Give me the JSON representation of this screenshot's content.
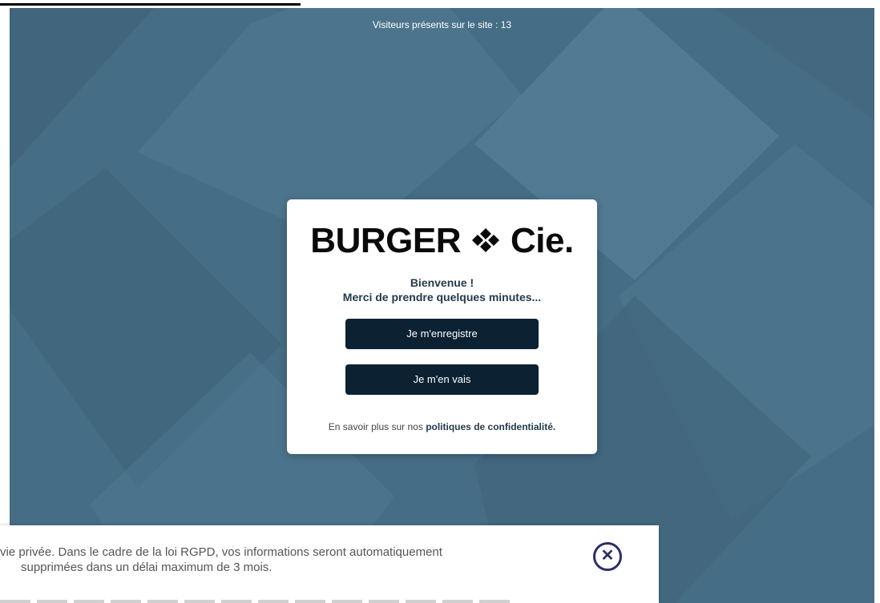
{
  "colors": {
    "background": "#466d86",
    "card": "#ffffff",
    "button": "#0c2233",
    "close_icon": "#2b2f67"
  },
  "header": {
    "visitors_text": "Visiteurs présents sur le site : 13"
  },
  "card": {
    "logo_left": "BURGER",
    "logo_right": "Cie.",
    "logo_icon": "diamond-cluster-icon",
    "welcome_line1": "Bienvenue !",
    "welcome_line2": "Merci de prendre quelques minutes...",
    "register_button": "Je m'enregistre",
    "leave_button": "Je m'en vais",
    "privacy_prefix": "En savoir plus sur nos",
    "privacy_link": "politiques de confidentialité."
  },
  "banner": {
    "line1": "vie privée. Dans le cadre de la loi RGPD, vos informations seront automatiquement",
    "line2": "supprimées dans un délai maximum de 3 mois.",
    "close_icon": "close-icon",
    "close_glyph": "✕"
  }
}
